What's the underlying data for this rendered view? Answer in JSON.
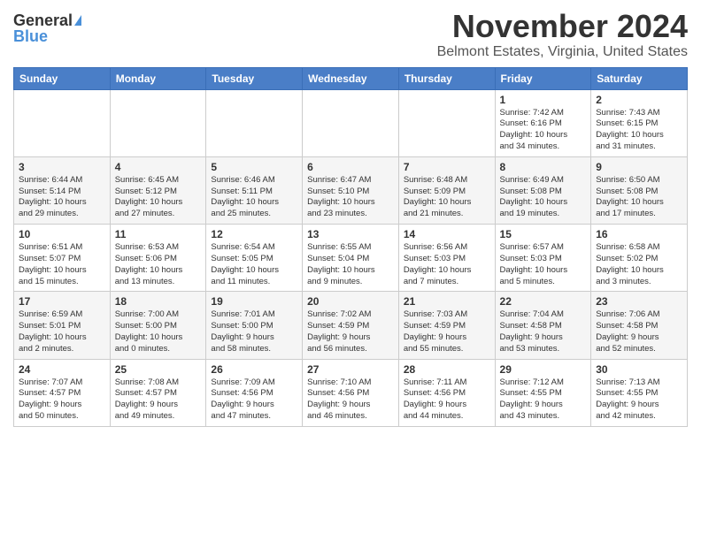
{
  "logo": {
    "general": "General",
    "blue": "Blue"
  },
  "title": "November 2024",
  "subtitle": "Belmont Estates, Virginia, United States",
  "weekdays": [
    "Sunday",
    "Monday",
    "Tuesday",
    "Wednesday",
    "Thursday",
    "Friday",
    "Saturday"
  ],
  "weeks": [
    [
      {
        "day": "",
        "info": ""
      },
      {
        "day": "",
        "info": ""
      },
      {
        "day": "",
        "info": ""
      },
      {
        "day": "",
        "info": ""
      },
      {
        "day": "",
        "info": ""
      },
      {
        "day": "1",
        "info": "Sunrise: 7:42 AM\nSunset: 6:16 PM\nDaylight: 10 hours\nand 34 minutes."
      },
      {
        "day": "2",
        "info": "Sunrise: 7:43 AM\nSunset: 6:15 PM\nDaylight: 10 hours\nand 31 minutes."
      }
    ],
    [
      {
        "day": "3",
        "info": "Sunrise: 6:44 AM\nSunset: 5:14 PM\nDaylight: 10 hours\nand 29 minutes."
      },
      {
        "day": "4",
        "info": "Sunrise: 6:45 AM\nSunset: 5:12 PM\nDaylight: 10 hours\nand 27 minutes."
      },
      {
        "day": "5",
        "info": "Sunrise: 6:46 AM\nSunset: 5:11 PM\nDaylight: 10 hours\nand 25 minutes."
      },
      {
        "day": "6",
        "info": "Sunrise: 6:47 AM\nSunset: 5:10 PM\nDaylight: 10 hours\nand 23 minutes."
      },
      {
        "day": "7",
        "info": "Sunrise: 6:48 AM\nSunset: 5:09 PM\nDaylight: 10 hours\nand 21 minutes."
      },
      {
        "day": "8",
        "info": "Sunrise: 6:49 AM\nSunset: 5:08 PM\nDaylight: 10 hours\nand 19 minutes."
      },
      {
        "day": "9",
        "info": "Sunrise: 6:50 AM\nSunset: 5:08 PM\nDaylight: 10 hours\nand 17 minutes."
      }
    ],
    [
      {
        "day": "10",
        "info": "Sunrise: 6:51 AM\nSunset: 5:07 PM\nDaylight: 10 hours\nand 15 minutes."
      },
      {
        "day": "11",
        "info": "Sunrise: 6:53 AM\nSunset: 5:06 PM\nDaylight: 10 hours\nand 13 minutes."
      },
      {
        "day": "12",
        "info": "Sunrise: 6:54 AM\nSunset: 5:05 PM\nDaylight: 10 hours\nand 11 minutes."
      },
      {
        "day": "13",
        "info": "Sunrise: 6:55 AM\nSunset: 5:04 PM\nDaylight: 10 hours\nand 9 minutes."
      },
      {
        "day": "14",
        "info": "Sunrise: 6:56 AM\nSunset: 5:03 PM\nDaylight: 10 hours\nand 7 minutes."
      },
      {
        "day": "15",
        "info": "Sunrise: 6:57 AM\nSunset: 5:03 PM\nDaylight: 10 hours\nand 5 minutes."
      },
      {
        "day": "16",
        "info": "Sunrise: 6:58 AM\nSunset: 5:02 PM\nDaylight: 10 hours\nand 3 minutes."
      }
    ],
    [
      {
        "day": "17",
        "info": "Sunrise: 6:59 AM\nSunset: 5:01 PM\nDaylight: 10 hours\nand 2 minutes."
      },
      {
        "day": "18",
        "info": "Sunrise: 7:00 AM\nSunset: 5:00 PM\nDaylight: 10 hours\nand 0 minutes."
      },
      {
        "day": "19",
        "info": "Sunrise: 7:01 AM\nSunset: 5:00 PM\nDaylight: 9 hours\nand 58 minutes."
      },
      {
        "day": "20",
        "info": "Sunrise: 7:02 AM\nSunset: 4:59 PM\nDaylight: 9 hours\nand 56 minutes."
      },
      {
        "day": "21",
        "info": "Sunrise: 7:03 AM\nSunset: 4:59 PM\nDaylight: 9 hours\nand 55 minutes."
      },
      {
        "day": "22",
        "info": "Sunrise: 7:04 AM\nSunset: 4:58 PM\nDaylight: 9 hours\nand 53 minutes."
      },
      {
        "day": "23",
        "info": "Sunrise: 7:06 AM\nSunset: 4:58 PM\nDaylight: 9 hours\nand 52 minutes."
      }
    ],
    [
      {
        "day": "24",
        "info": "Sunrise: 7:07 AM\nSunset: 4:57 PM\nDaylight: 9 hours\nand 50 minutes."
      },
      {
        "day": "25",
        "info": "Sunrise: 7:08 AM\nSunset: 4:57 PM\nDaylight: 9 hours\nand 49 minutes."
      },
      {
        "day": "26",
        "info": "Sunrise: 7:09 AM\nSunset: 4:56 PM\nDaylight: 9 hours\nand 47 minutes."
      },
      {
        "day": "27",
        "info": "Sunrise: 7:10 AM\nSunset: 4:56 PM\nDaylight: 9 hours\nand 46 minutes."
      },
      {
        "day": "28",
        "info": "Sunrise: 7:11 AM\nSunset: 4:56 PM\nDaylight: 9 hours\nand 44 minutes."
      },
      {
        "day": "29",
        "info": "Sunrise: 7:12 AM\nSunset: 4:55 PM\nDaylight: 9 hours\nand 43 minutes."
      },
      {
        "day": "30",
        "info": "Sunrise: 7:13 AM\nSunset: 4:55 PM\nDaylight: 9 hours\nand 42 minutes."
      }
    ]
  ]
}
